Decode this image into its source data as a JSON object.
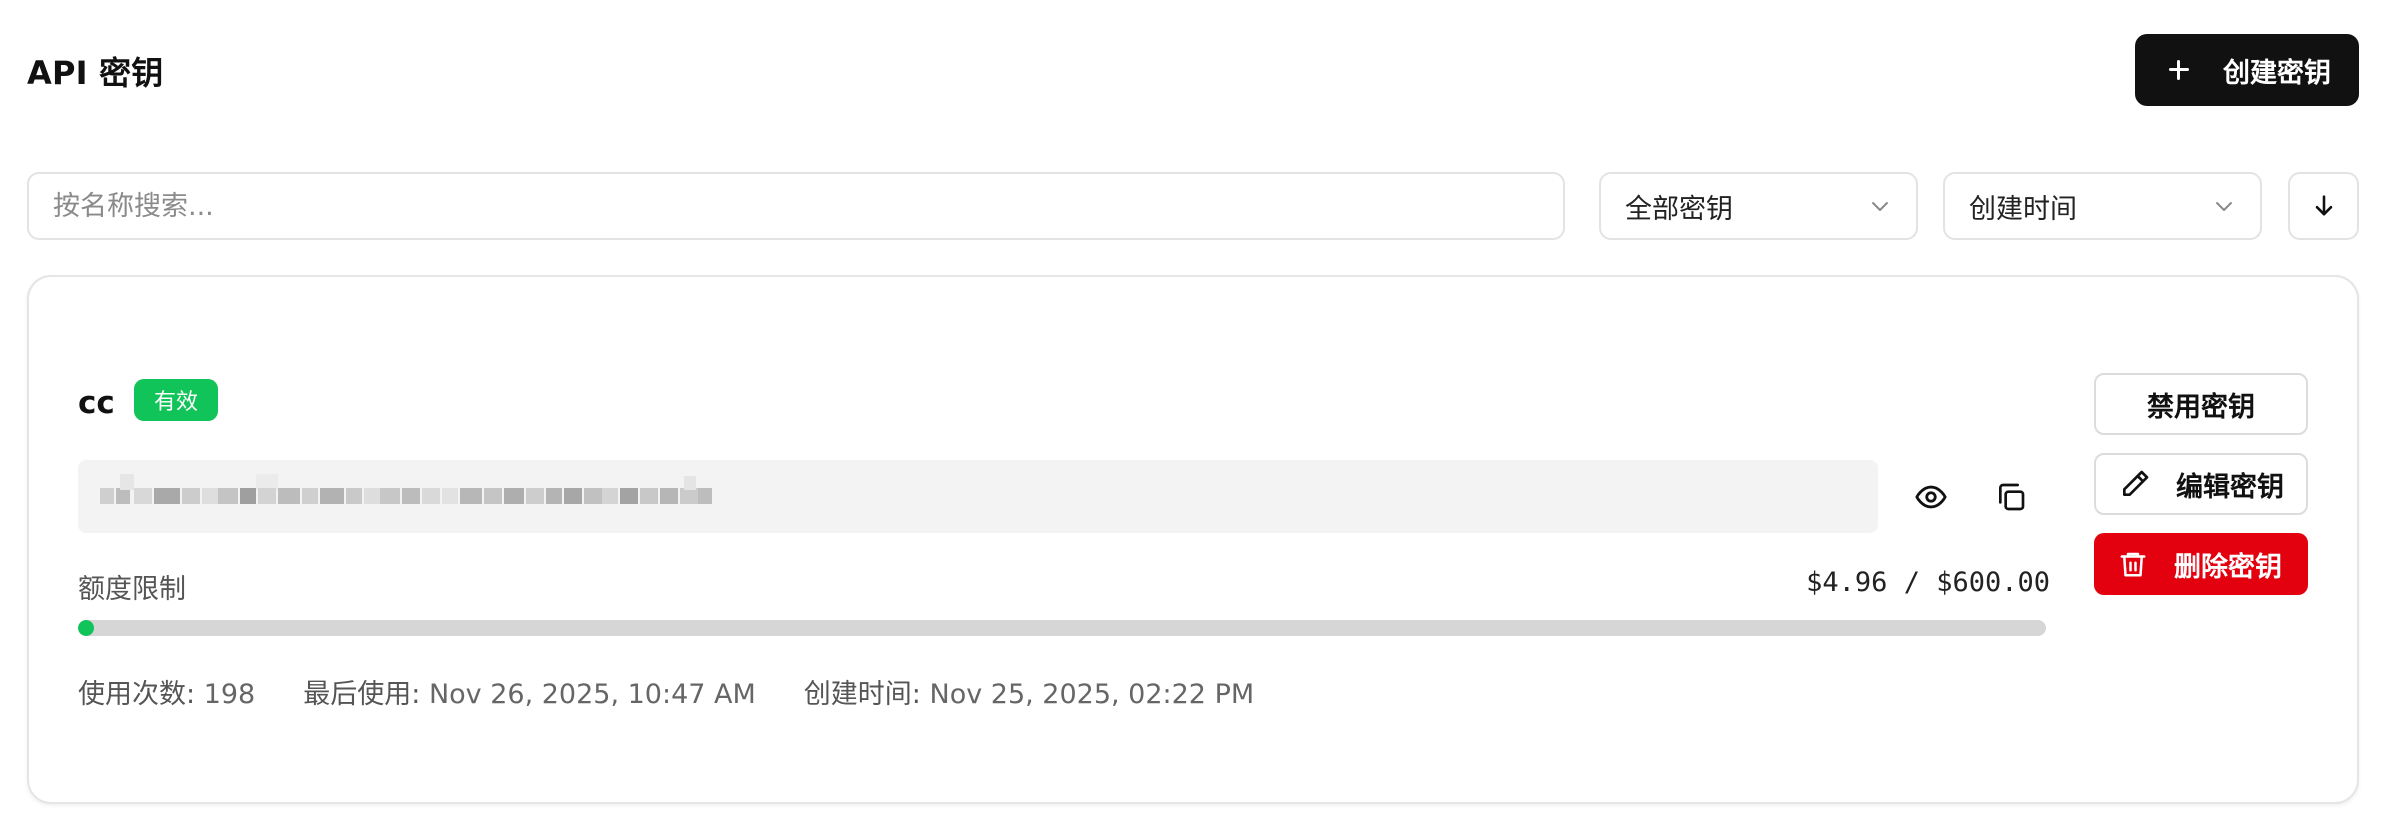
{
  "header": {
    "title": "API 密钥",
    "create_button_label": "创建密钥",
    "create_button_icon": "plus-icon"
  },
  "filters": {
    "search_placeholder": "按名称搜索...",
    "search_value": "",
    "status_filter": {
      "selected": "全部密钥",
      "icon": "chevron-down-icon"
    },
    "sort_by": {
      "selected": "创建时间",
      "icon": "chevron-down-icon"
    },
    "sort_direction_icon": "arrow-down-icon"
  },
  "keys": [
    {
      "name": "cc",
      "status": "有效",
      "status_color": "#11c45a",
      "key_masked": true,
      "reveal_icon": "eye-icon",
      "copy_icon": "copy-icon",
      "quota_label": "额度限制",
      "quota_text": "$4.96 / $600.00",
      "quota_used": 4.96,
      "quota_limit": 600.0,
      "usage_count_label": "使用次数:",
      "usage_count": "198",
      "last_used_label": "最后使用:",
      "last_used": "Nov 26, 2025, 10:47 AM",
      "created_label": "创建时间:",
      "created": "Nov 25, 2025, 02:22 PM",
      "actions": {
        "disable_label": "禁用密钥",
        "edit_label": "编辑密钥",
        "edit_icon": "pencil-icon",
        "delete_label": "删除密钥",
        "delete_icon": "trash-icon",
        "delete_color": "#e3000f"
      }
    }
  ],
  "colors": {
    "primary_button": "#111111",
    "active_badge": "#11c45a",
    "danger": "#e3000f",
    "progress_track": "#d6d6d6"
  }
}
